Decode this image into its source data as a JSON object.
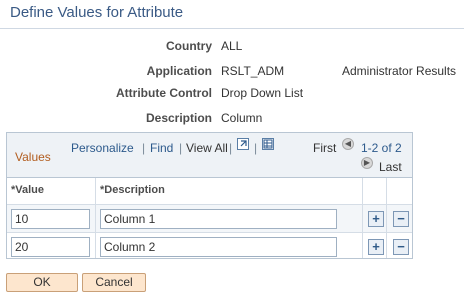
{
  "page": {
    "title": "Define Values for Attribute"
  },
  "fields": [
    {
      "label": "Country",
      "value": "ALL"
    },
    {
      "label": "Application",
      "value": "RSLT_ADM",
      "extra": "Administrator Results"
    },
    {
      "label": "Attribute Control",
      "value": "Drop Down List"
    },
    {
      "label": "Description",
      "value": "Column"
    }
  ],
  "grid": {
    "title": "Values",
    "personalize": "Personalize",
    "find": "Find",
    "view_all": "View All",
    "first": "First",
    "range": "1-2 of 2",
    "last": "Last",
    "columns": {
      "value": "*Value",
      "description": "*Description"
    },
    "rows": [
      {
        "value": "10",
        "description": "Column 1"
      },
      {
        "value": "20",
        "description": "Column 2"
      }
    ],
    "add_symbol": "+",
    "delete_symbol": "−"
  },
  "buttons": {
    "ok": "OK",
    "cancel": "Cancel"
  },
  "colors": {
    "title": "#3a5a85",
    "link": "#2d5a8c",
    "grid_title": "#b25d1f",
    "button_bg": "#fde6ce"
  }
}
